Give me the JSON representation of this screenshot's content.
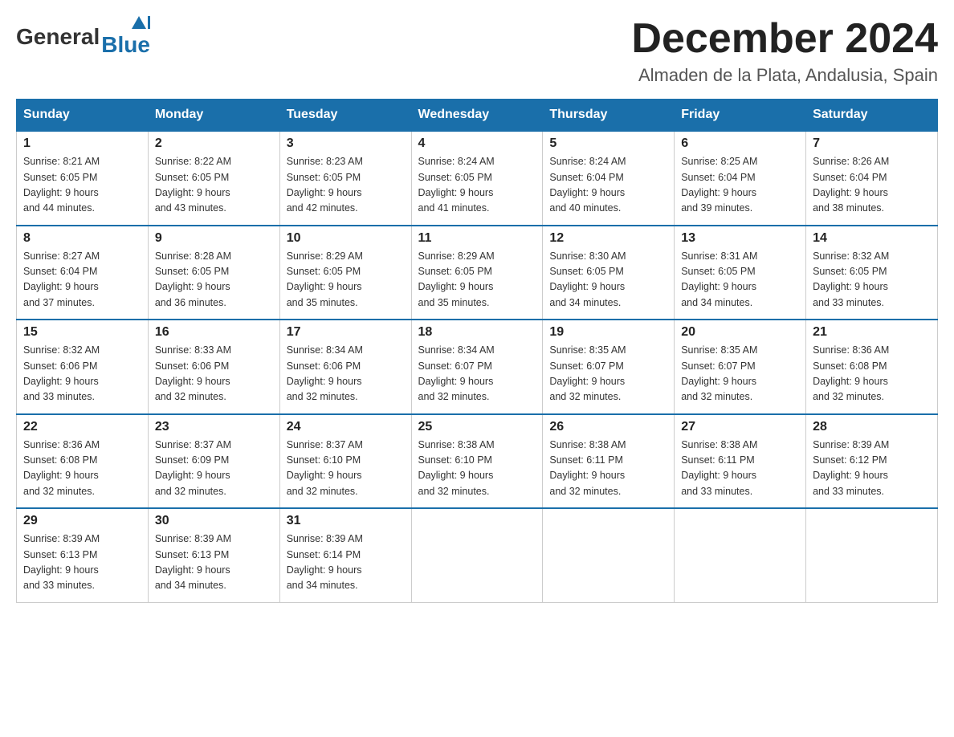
{
  "header": {
    "logo": {
      "general": "General",
      "blue": "Blue",
      "triangle_symbol": "▲"
    },
    "title": "December 2024",
    "location": "Almaden de la Plata, Andalusia, Spain"
  },
  "days_of_week": [
    "Sunday",
    "Monday",
    "Tuesday",
    "Wednesday",
    "Thursday",
    "Friday",
    "Saturday"
  ],
  "weeks": [
    [
      {
        "day": "1",
        "sunrise": "8:21 AM",
        "sunset": "6:05 PM",
        "daylight": "9 hours and 44 minutes."
      },
      {
        "day": "2",
        "sunrise": "8:22 AM",
        "sunset": "6:05 PM",
        "daylight": "9 hours and 43 minutes."
      },
      {
        "day": "3",
        "sunrise": "8:23 AM",
        "sunset": "6:05 PM",
        "daylight": "9 hours and 42 minutes."
      },
      {
        "day": "4",
        "sunrise": "8:24 AM",
        "sunset": "6:05 PM",
        "daylight": "9 hours and 41 minutes."
      },
      {
        "day": "5",
        "sunrise": "8:24 AM",
        "sunset": "6:04 PM",
        "daylight": "9 hours and 40 minutes."
      },
      {
        "day": "6",
        "sunrise": "8:25 AM",
        "sunset": "6:04 PM",
        "daylight": "9 hours and 39 minutes."
      },
      {
        "day": "7",
        "sunrise": "8:26 AM",
        "sunset": "6:04 PM",
        "daylight": "9 hours and 38 minutes."
      }
    ],
    [
      {
        "day": "8",
        "sunrise": "8:27 AM",
        "sunset": "6:04 PM",
        "daylight": "9 hours and 37 minutes."
      },
      {
        "day": "9",
        "sunrise": "8:28 AM",
        "sunset": "6:05 PM",
        "daylight": "9 hours and 36 minutes."
      },
      {
        "day": "10",
        "sunrise": "8:29 AM",
        "sunset": "6:05 PM",
        "daylight": "9 hours and 35 minutes."
      },
      {
        "day": "11",
        "sunrise": "8:29 AM",
        "sunset": "6:05 PM",
        "daylight": "9 hours and 35 minutes."
      },
      {
        "day": "12",
        "sunrise": "8:30 AM",
        "sunset": "6:05 PM",
        "daylight": "9 hours and 34 minutes."
      },
      {
        "day": "13",
        "sunrise": "8:31 AM",
        "sunset": "6:05 PM",
        "daylight": "9 hours and 34 minutes."
      },
      {
        "day": "14",
        "sunrise": "8:32 AM",
        "sunset": "6:05 PM",
        "daylight": "9 hours and 33 minutes."
      }
    ],
    [
      {
        "day": "15",
        "sunrise": "8:32 AM",
        "sunset": "6:06 PM",
        "daylight": "9 hours and 33 minutes."
      },
      {
        "day": "16",
        "sunrise": "8:33 AM",
        "sunset": "6:06 PM",
        "daylight": "9 hours and 32 minutes."
      },
      {
        "day": "17",
        "sunrise": "8:34 AM",
        "sunset": "6:06 PM",
        "daylight": "9 hours and 32 minutes."
      },
      {
        "day": "18",
        "sunrise": "8:34 AM",
        "sunset": "6:07 PM",
        "daylight": "9 hours and 32 minutes."
      },
      {
        "day": "19",
        "sunrise": "8:35 AM",
        "sunset": "6:07 PM",
        "daylight": "9 hours and 32 minutes."
      },
      {
        "day": "20",
        "sunrise": "8:35 AM",
        "sunset": "6:07 PM",
        "daylight": "9 hours and 32 minutes."
      },
      {
        "day": "21",
        "sunrise": "8:36 AM",
        "sunset": "6:08 PM",
        "daylight": "9 hours and 32 minutes."
      }
    ],
    [
      {
        "day": "22",
        "sunrise": "8:36 AM",
        "sunset": "6:08 PM",
        "daylight": "9 hours and 32 minutes."
      },
      {
        "day": "23",
        "sunrise": "8:37 AM",
        "sunset": "6:09 PM",
        "daylight": "9 hours and 32 minutes."
      },
      {
        "day": "24",
        "sunrise": "8:37 AM",
        "sunset": "6:10 PM",
        "daylight": "9 hours and 32 minutes."
      },
      {
        "day": "25",
        "sunrise": "8:38 AM",
        "sunset": "6:10 PM",
        "daylight": "9 hours and 32 minutes."
      },
      {
        "day": "26",
        "sunrise": "8:38 AM",
        "sunset": "6:11 PM",
        "daylight": "9 hours and 32 minutes."
      },
      {
        "day": "27",
        "sunrise": "8:38 AM",
        "sunset": "6:11 PM",
        "daylight": "9 hours and 33 minutes."
      },
      {
        "day": "28",
        "sunrise": "8:39 AM",
        "sunset": "6:12 PM",
        "daylight": "9 hours and 33 minutes."
      }
    ],
    [
      {
        "day": "29",
        "sunrise": "8:39 AM",
        "sunset": "6:13 PM",
        "daylight": "9 hours and 33 minutes."
      },
      {
        "day": "30",
        "sunrise": "8:39 AM",
        "sunset": "6:13 PM",
        "daylight": "9 hours and 34 minutes."
      },
      {
        "day": "31",
        "sunrise": "8:39 AM",
        "sunset": "6:14 PM",
        "daylight": "9 hours and 34 minutes."
      },
      null,
      null,
      null,
      null
    ]
  ],
  "labels": {
    "sunrise": "Sunrise:",
    "sunset": "Sunset:",
    "daylight": "Daylight:"
  }
}
